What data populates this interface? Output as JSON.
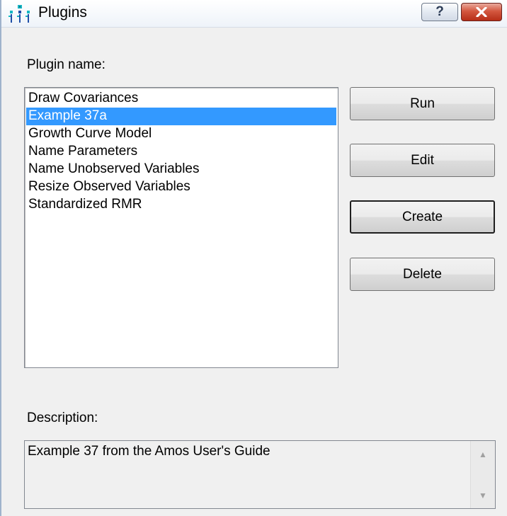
{
  "window": {
    "title": "Plugins",
    "icon": "plugins-app-icon",
    "help_glyph": "?",
    "close_icon": "close-icon"
  },
  "plugin_list": {
    "label": "Plugin name:",
    "items": [
      {
        "label": "Draw Covariances",
        "selected": false
      },
      {
        "label": "Example 37a",
        "selected": true
      },
      {
        "label": "Growth Curve Model",
        "selected": false
      },
      {
        "label": "Name Parameters",
        "selected": false
      },
      {
        "label": "Name Unobserved Variables",
        "selected": false
      },
      {
        "label": "Resize Observed Variables",
        "selected": false
      },
      {
        "label": "Standardized RMR",
        "selected": false
      }
    ]
  },
  "buttons": {
    "run": "Run",
    "edit": "Edit",
    "create": "Create",
    "delete": "Delete"
  },
  "description": {
    "label": "Description:",
    "text": "Example 37 from the Amos User's Guide",
    "scroll_up_glyph": "▲",
    "scroll_down_glyph": "▼"
  },
  "colors": {
    "selection": "#3399ff",
    "close_button": "#c8432a",
    "window_background": "#f0f0f0"
  }
}
